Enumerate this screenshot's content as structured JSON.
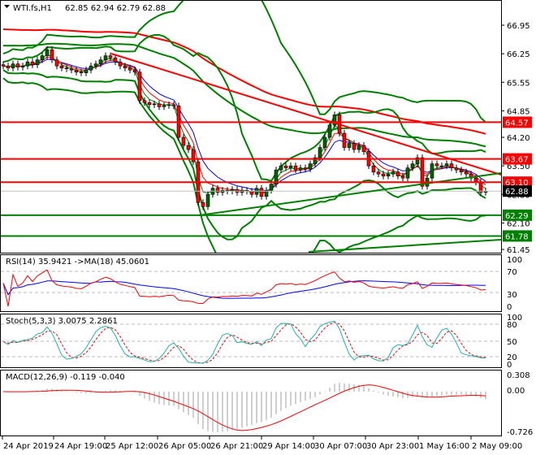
{
  "header": {
    "symbol": "WTI.fs,H1",
    "ohlc": "62.85 62.94 62.79 62.88"
  },
  "price_axis": {
    "ticks": [
      "66.95",
      "66.25",
      "65.55",
      "64.85",
      "64.20",
      "63.50",
      "62.80",
      "62.10",
      "61.45"
    ],
    "levels": [
      {
        "value": "64.57",
        "color": "#ff0000"
      },
      {
        "value": "63.67",
        "color": "#ff0000"
      },
      {
        "value": "63.10",
        "color": "#ff0000"
      },
      {
        "value": "62.88",
        "color": "#000000"
      },
      {
        "value": "62.29",
        "color": "#008000"
      },
      {
        "value": "61.78",
        "color": "#008000"
      }
    ]
  },
  "rsi": {
    "label": "RSI(14) 35.9421  ->MA(18) 45.0601",
    "ticks": [
      "100",
      "70",
      "30",
      "0"
    ]
  },
  "stoch": {
    "label": "Stoch(5,3,3) 3.0075 2.2861",
    "ticks": [
      "100",
      "80",
      "50",
      "20",
      "0"
    ]
  },
  "macd": {
    "label": "MACD(12,26,9) -0.119 -0.040",
    "ticks": [
      "0.308",
      "0.00",
      "-0.726"
    ]
  },
  "time_axis": [
    "24 Apr 2019",
    "24 Apr 19:00",
    "25 Apr 12:00",
    "26 Apr 05:00",
    "26 Apr 21:00",
    "29 Apr 14:00",
    "30 Apr 07:00",
    "30 Apr 23:00",
    "1 May 16:00",
    "2 May 09:00"
  ],
  "colors": {
    "bull": "#006400",
    "bear": "#ff0000",
    "support": "#008000",
    "resistance": "#ff0000"
  },
  "chart_data": {
    "type": "candlestick",
    "title": "WTI.fs,H1",
    "ylim": [
      61.45,
      66.95
    ],
    "closes": [
      65.95,
      65.9,
      66.0,
      65.92,
      65.95,
      66.05,
      65.98,
      66.1,
      66.2,
      66.35,
      66.1,
      65.95,
      65.9,
      65.88,
      65.85,
      65.8,
      65.78,
      65.85,
      65.95,
      66.0,
      66.1,
      66.2,
      66.15,
      66.05,
      65.95,
      65.9,
      65.85,
      65.8,
      65.1,
      65.05,
      65.0,
      65.02,
      64.95,
      64.98,
      65.0,
      64.97,
      64.2,
      64.0,
      63.9,
      63.6,
      62.6,
      62.5,
      62.8,
      62.95,
      62.85,
      62.9,
      62.88,
      62.92,
      62.85,
      62.9,
      62.88,
      62.8,
      62.95,
      62.75,
      62.9,
      63.05,
      63.4,
      63.5,
      63.45,
      63.5,
      63.4,
      63.45,
      63.42,
      63.55,
      63.7,
      63.95,
      64.2,
      64.5,
      64.75,
      64.3,
      63.95,
      64.05,
      63.9,
      64.0,
      63.85,
      63.5,
      63.35,
      63.3,
      63.25,
      63.3,
      63.35,
      63.25,
      63.2,
      63.45,
      63.55,
      63.7,
      63.0,
      63.2,
      63.55,
      63.5,
      63.5,
      63.55,
      63.45,
      63.4,
      63.35,
      63.3,
      63.2,
      63.1,
      62.85,
      62.88
    ]
  }
}
